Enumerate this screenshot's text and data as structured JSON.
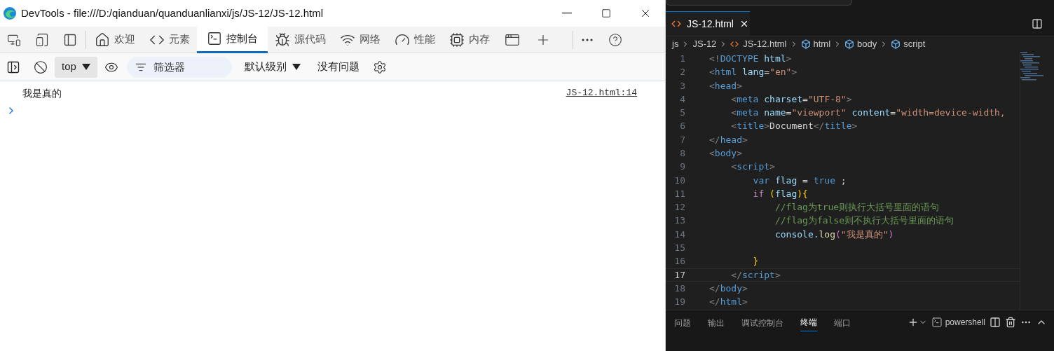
{
  "devtools": {
    "window": {
      "title": "DevTools - file:///D:/qianduan/quanduanlianxi/js/JS-12/JS-12.html"
    },
    "tabs": [
      {
        "label": "欢迎",
        "selected": false
      },
      {
        "label": "元素",
        "selected": false
      },
      {
        "label": "控制台",
        "selected": true
      },
      {
        "label": "源代码",
        "selected": false
      },
      {
        "label": "网络",
        "selected": false
      },
      {
        "label": "性能",
        "selected": false
      },
      {
        "label": "内存",
        "selected": false
      }
    ],
    "console_toolbar": {
      "context": "top",
      "filter": {
        "placeholder": "筛选器"
      },
      "level": "默认级别",
      "issues": "没有问题"
    },
    "console": {
      "messages": [
        {
          "text": "我是真的",
          "source": "JS-12.html:14"
        }
      ]
    }
  },
  "editor": {
    "tabs": [
      {
        "label": "JS-12.html",
        "selected": true
      }
    ],
    "breadcrumbs": [
      "js",
      "JS-12",
      "JS-12.html",
      "html",
      "body",
      "script"
    ],
    "lines": [
      {
        "number": "1",
        "current": false,
        "tokens": [
          {
            "kind": "punct",
            "text": "<!"
          },
          {
            "kind": "tag",
            "text": "DOCTYPE"
          },
          {
            "kind": "attr",
            "text": " html"
          },
          {
            "kind": "punct",
            "text": ">"
          }
        ]
      },
      {
        "number": "2",
        "current": false,
        "tokens": [
          {
            "kind": "punct",
            "text": "<"
          },
          {
            "kind": "tag",
            "text": "html"
          },
          {
            "kind": "attr",
            "text": " lang"
          },
          {
            "kind": "text",
            "text": "="
          },
          {
            "kind": "str",
            "text": "\"en\""
          },
          {
            "kind": "punct",
            "text": ">"
          }
        ]
      },
      {
        "number": "3",
        "current": false,
        "tokens": [
          {
            "kind": "punct",
            "text": "<"
          },
          {
            "kind": "tag",
            "text": "head"
          },
          {
            "kind": "punct",
            "text": ">"
          }
        ]
      },
      {
        "number": "4",
        "current": false,
        "tokens": [
          {
            "kind": "punct",
            "text": "    <"
          },
          {
            "kind": "tag",
            "text": "meta"
          },
          {
            "kind": "attr",
            "text": " charset"
          },
          {
            "kind": "text",
            "text": "="
          },
          {
            "kind": "str",
            "text": "\"UTF-8\""
          },
          {
            "kind": "punct",
            "text": ">"
          }
        ]
      },
      {
        "number": "5",
        "current": false,
        "tokens": [
          {
            "kind": "punct",
            "text": "    <"
          },
          {
            "kind": "tag",
            "text": "meta"
          },
          {
            "kind": "attr",
            "text": " name"
          },
          {
            "kind": "text",
            "text": "="
          },
          {
            "kind": "str",
            "text": "\"viewport\""
          },
          {
            "kind": "attr",
            "text": " content"
          },
          {
            "kind": "text",
            "text": "="
          },
          {
            "kind": "str",
            "text": "\"width=device-width,"
          }
        ]
      },
      {
        "number": "6",
        "current": false,
        "tokens": [
          {
            "kind": "punct",
            "text": "    <"
          },
          {
            "kind": "tag",
            "text": "title"
          },
          {
            "kind": "punct",
            "text": ">"
          },
          {
            "kind": "text",
            "text": "Document"
          },
          {
            "kind": "punct",
            "text": "</"
          },
          {
            "kind": "tag",
            "text": "title"
          },
          {
            "kind": "punct",
            "text": ">"
          }
        ]
      },
      {
        "number": "7",
        "current": false,
        "tokens": [
          {
            "kind": "punct",
            "text": "</"
          },
          {
            "kind": "tag",
            "text": "head"
          },
          {
            "kind": "punct",
            "text": ">"
          }
        ]
      },
      {
        "number": "8",
        "current": false,
        "tokens": [
          {
            "kind": "punct",
            "text": "<"
          },
          {
            "kind": "tag",
            "text": "body"
          },
          {
            "kind": "punct",
            "text": ">"
          }
        ]
      },
      {
        "number": "9",
        "current": false,
        "tokens": [
          {
            "kind": "punct",
            "text": "    <"
          },
          {
            "kind": "tag",
            "text": "script"
          },
          {
            "kind": "punct",
            "text": ">"
          }
        ]
      },
      {
        "number": "10",
        "current": false,
        "tokens": [
          {
            "kind": "kw",
            "text": "        var"
          },
          {
            "kind": "var",
            "text": " flag"
          },
          {
            "kind": "text",
            "text": " = "
          },
          {
            "kind": "kw",
            "text": "true"
          },
          {
            "kind": "text",
            "text": " ;"
          }
        ]
      },
      {
        "number": "11",
        "current": false,
        "tokens": [
          {
            "kind": "ctrl",
            "text": "        if"
          },
          {
            "kind": "brace",
            "text": " ("
          },
          {
            "kind": "var",
            "text": "flag"
          },
          {
            "kind": "brace",
            "text": ")"
          },
          {
            "kind": "brace",
            "text": "{"
          }
        ]
      },
      {
        "number": "12",
        "current": false,
        "tokens": [
          {
            "kind": "comment",
            "text": "            //flag为true则执行大括号里面的语句"
          }
        ]
      },
      {
        "number": "13",
        "current": false,
        "tokens": [
          {
            "kind": "comment",
            "text": "            //flag为false则不执行大括号里面的语句"
          }
        ]
      },
      {
        "number": "14",
        "current": false,
        "tokens": [
          {
            "kind": "var",
            "text": "            console."
          },
          {
            "kind": "fn",
            "text": "log"
          },
          {
            "kind": "paren",
            "text": "("
          },
          {
            "kind": "str",
            "text": "\"我是真的\""
          },
          {
            "kind": "paren",
            "text": ")"
          }
        ]
      },
      {
        "number": "15",
        "current": false
      },
      {
        "number": "16",
        "current": false,
        "tokens": [
          {
            "kind": "brace",
            "text": "        }"
          }
        ]
      },
      {
        "number": "17",
        "current": true,
        "tokens": [
          {
            "kind": "punct",
            "text": "    </"
          },
          {
            "kind": "tag",
            "text": "script"
          },
          {
            "kind": "punct",
            "text": ">"
          }
        ]
      },
      {
        "number": "18",
        "current": false,
        "tokens": [
          {
            "kind": "punct",
            "text": "</"
          },
          {
            "kind": "tag",
            "text": "body"
          },
          {
            "kind": "punct",
            "text": ">"
          }
        ]
      },
      {
        "number": "19",
        "current": false,
        "tokens": [
          {
            "kind": "punct",
            "text": "</"
          },
          {
            "kind": "tag",
            "text": "html"
          },
          {
            "kind": "punct",
            "text": ">"
          }
        ]
      }
    ]
  },
  "panel": {
    "tabs": [
      {
        "label": "问题",
        "selected": false
      },
      {
        "label": "输出",
        "selected": false
      },
      {
        "label": "调试控制台",
        "selected": false
      },
      {
        "label": "终端",
        "selected": true
      },
      {
        "label": "端口",
        "selected": false
      }
    ],
    "terminal": "powershell"
  }
}
